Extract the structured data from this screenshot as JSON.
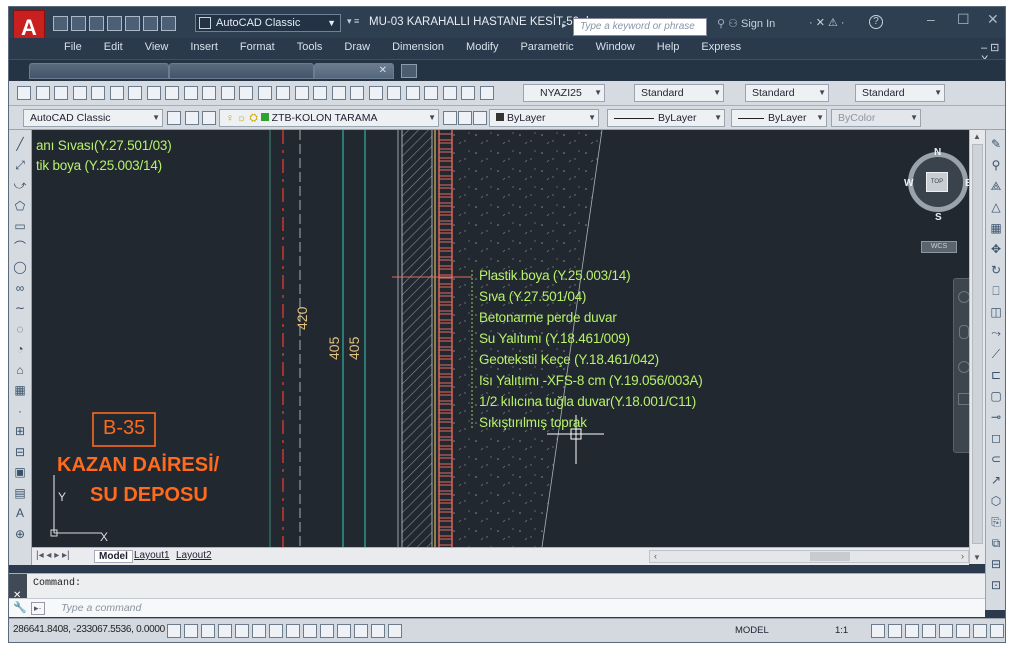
{
  "app": {
    "logo_letter": "A",
    "workspace": "AutoCAD Classic",
    "document_title": "MU-03 KARAHALLI HASTANE KESİT-50.dwg",
    "search_placeholder": "Type a keyword or phrase",
    "sign_in": "Sign In",
    "help": "?"
  },
  "menu": [
    "File",
    "Edit",
    "View",
    "Insert",
    "Format",
    "Tools",
    "Draw",
    "Dimension",
    "Modify",
    "Parametric",
    "Window",
    "Help",
    "Express"
  ],
  "toolbar": {
    "text_style": "NYAZI25",
    "dim_style": "Standard",
    "table_style": "Standard",
    "multileader_style": "Standard",
    "workspace_dd": "AutoCAD Classic",
    "layer": "ZTB-KOLON TARAMA",
    "color": "ByLayer",
    "linetype": "ByLayer",
    "lineweight": "ByLayer",
    "plotstyle": "ByColor"
  },
  "drawing": {
    "top_left_label_1": "anı Sıvası(Y.27.501/03)",
    "top_left_label_2": "tik boya (Y.25.003/14)",
    "dimensions": [
      "420",
      "405",
      "405"
    ],
    "layers_callout": [
      "Plastik boya (Y.25.003/14)",
      "Sıva (Y.27.501/04)",
      "Betonarme perde duvar",
      "Su Yalıtımı (Y.18.461/009)",
      "Geotekstil Keçe (Y.18.461/042)",
      "Isı Yalıtımı -XFS-8 cm (Y.19.056/003A)",
      "1/2 kılıcına tuğla duvar(Y.18.001/C11)",
      "Sıkıştırılmış toprak"
    ],
    "tag": "B-35",
    "room_line_1": "KAZAN DAİRESİ/",
    "room_line_2": "SU DEPOSU",
    "ucs_y": "Y",
    "ucs_x": "X"
  },
  "viewcube": {
    "n": "N",
    "s": "S",
    "e": "E",
    "w": "W",
    "top": "TOP",
    "wcs": "WCS"
  },
  "layouts": {
    "model": "Model",
    "layout1": "Layout1",
    "layout2": "Layout2"
  },
  "command": {
    "history": "Command:",
    "placeholder": "Type a command"
  },
  "status": {
    "coords": "286641.8408, -233067.5536, 0.0000",
    "model": "MODEL",
    "scale": "1:1"
  },
  "colors": {
    "canvas": "#212830",
    "annot_green": "#b7f26a",
    "orange": "#ff6a1c",
    "pipe_red": "#e03c31",
    "teal": "#2fb3a0"
  }
}
